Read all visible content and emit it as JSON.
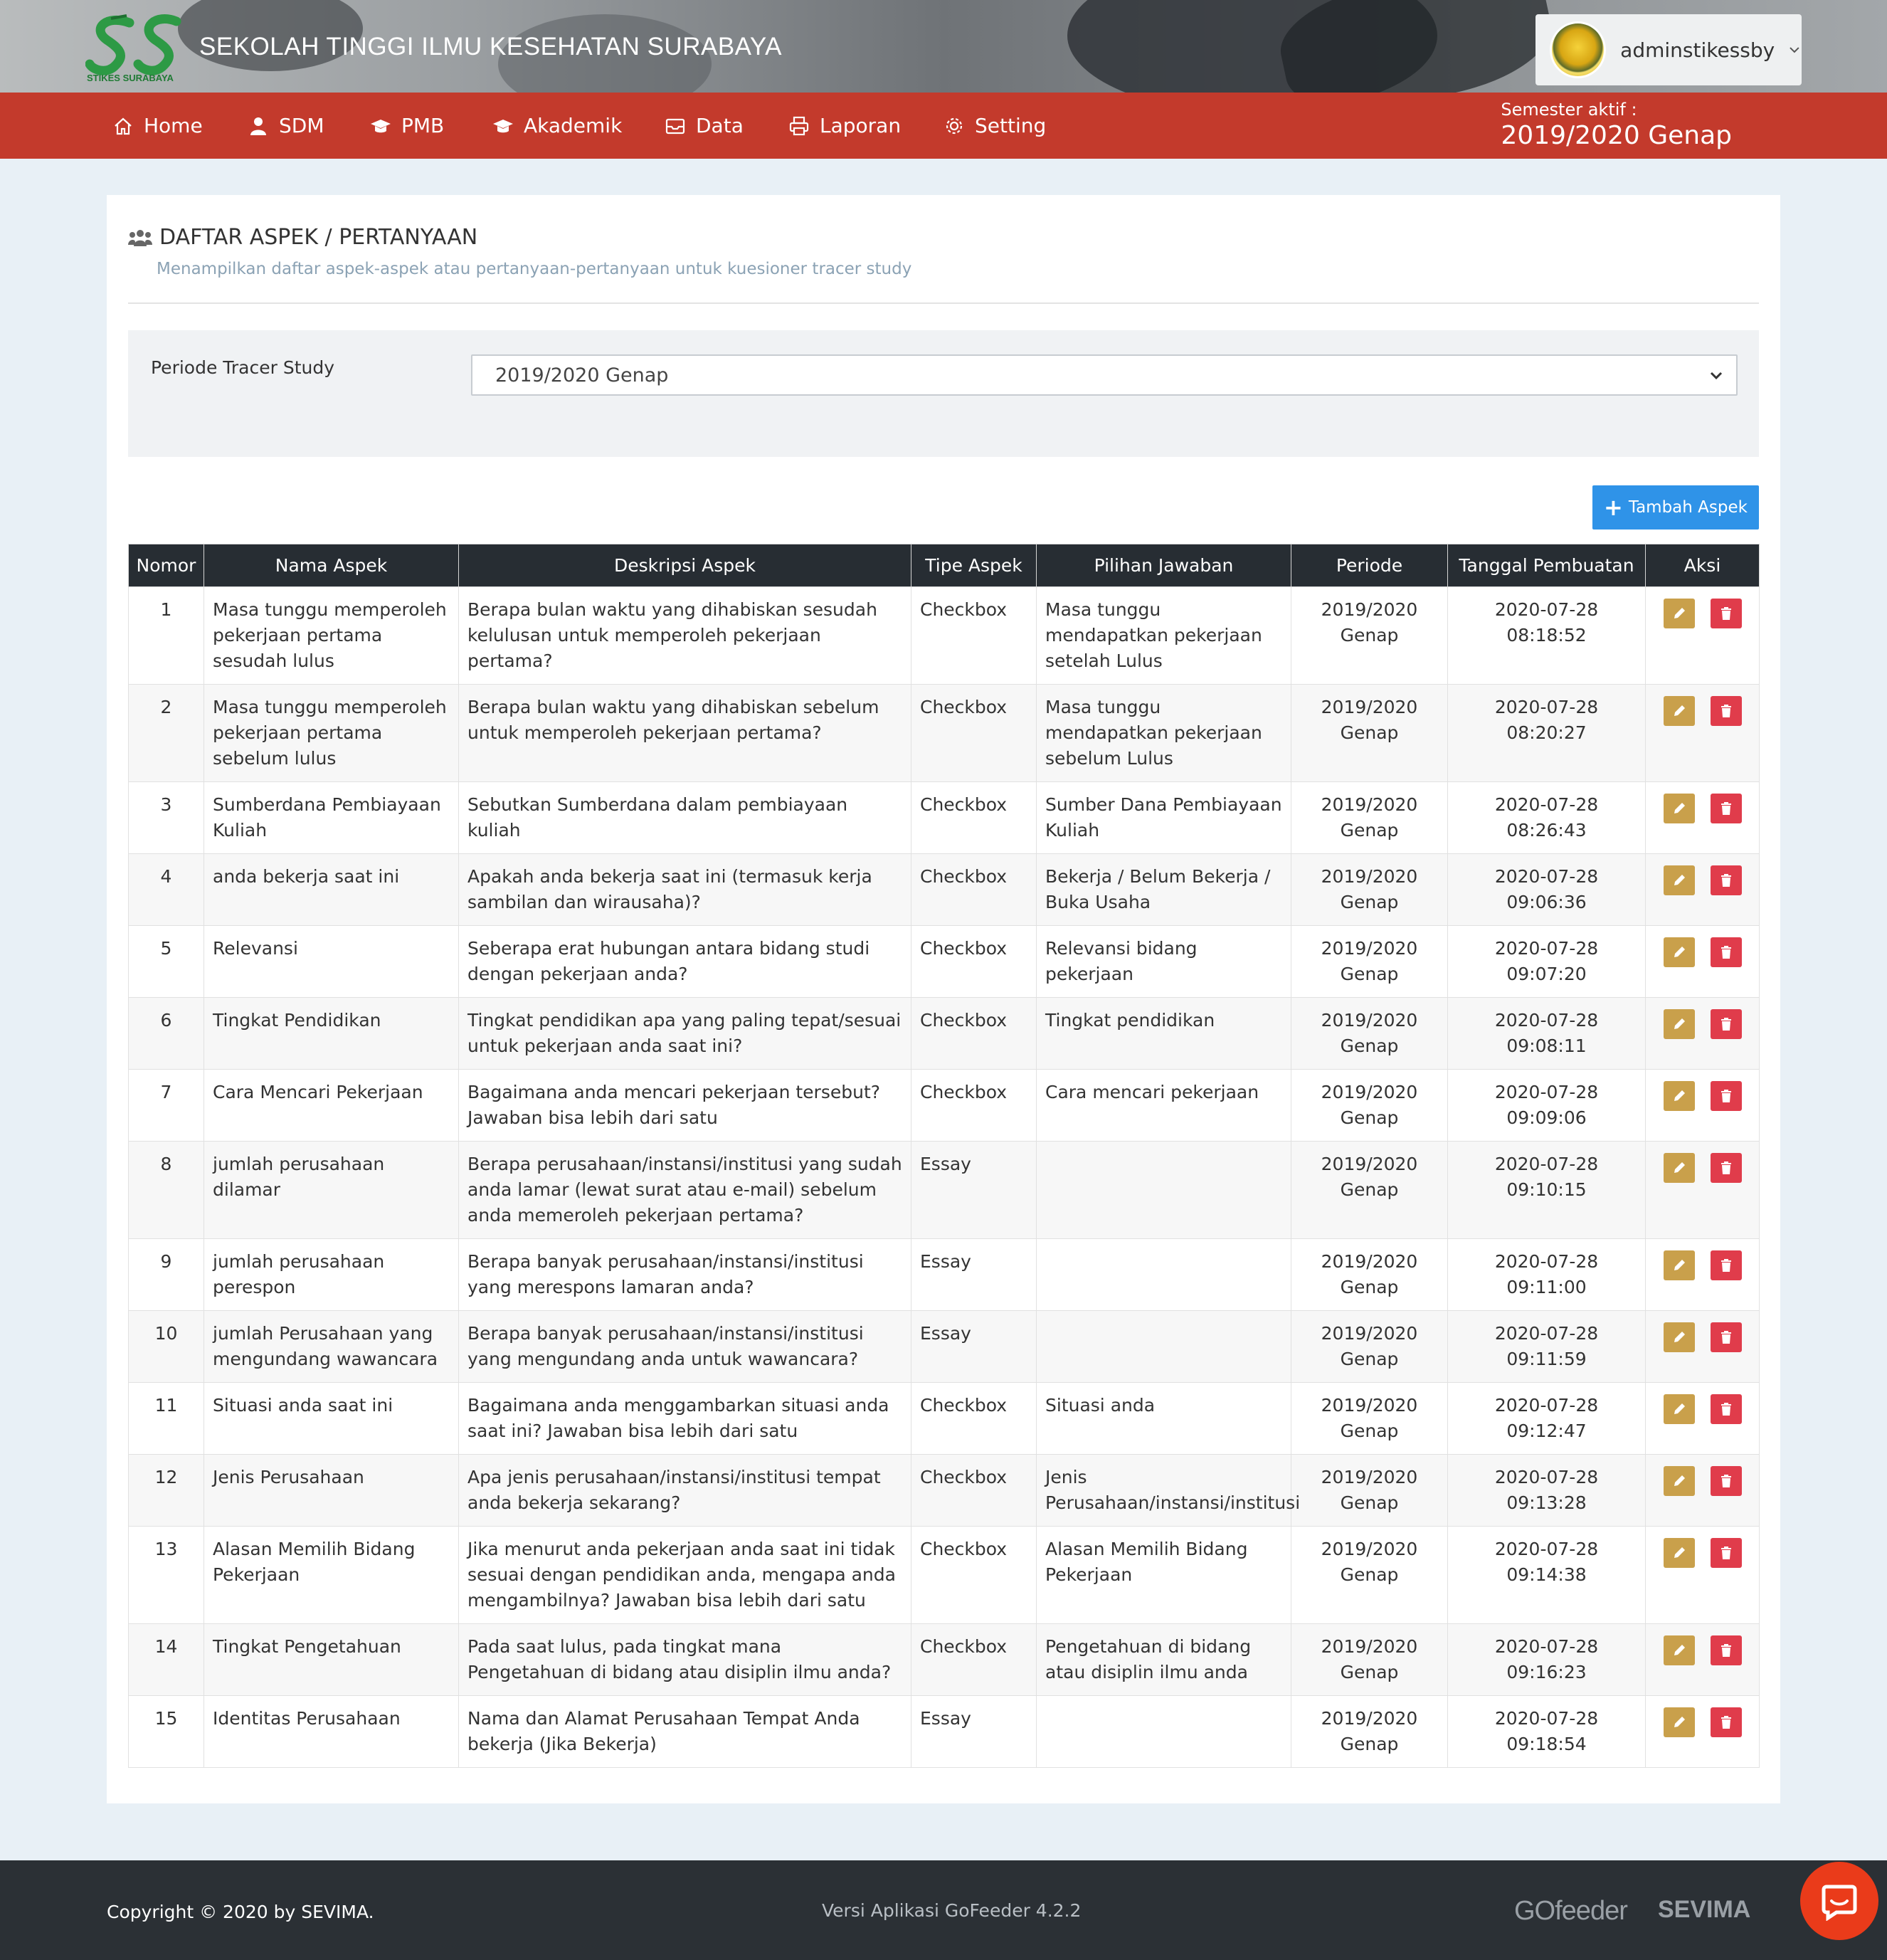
{
  "header": {
    "logo_caption": "STIKES SURABAYA",
    "site_title": "SEKOLAH TINGGI ILMU KESEHATAN SURABAYA",
    "username": "adminstikessby"
  },
  "nav": {
    "items": [
      {
        "label": "Home",
        "icon": "home-icon"
      },
      {
        "label": "SDM",
        "icon": "user-icon"
      },
      {
        "label": "PMB",
        "icon": "graduation-cap-icon"
      },
      {
        "label": "Akademik",
        "icon": "graduation-cap-icon"
      },
      {
        "label": "Data",
        "icon": "inbox-icon"
      },
      {
        "label": "Laporan",
        "icon": "print-icon"
      },
      {
        "label": "Setting",
        "icon": "gear-icon"
      }
    ],
    "semester_label": "Semester aktif :",
    "semester_value": "2019/2020 Genap"
  },
  "page": {
    "title": "DAFTAR ASPEK / PERTANYAAN",
    "subtitle": "Menampilkan daftar aspek-aspek atau pertanyaan-pertanyaan untuk kuesioner tracer study",
    "filter_label": "Periode Tracer Study",
    "filter_value": "2019/2020 Genap",
    "add_button": "Tambah Aspek"
  },
  "table": {
    "headers": [
      "Nomor",
      "Nama Aspek",
      "Deskripsi Aspek",
      "Tipe Aspek",
      "Pilihan Jawaban",
      "Periode",
      "Tanggal Pembuatan",
      "Aksi"
    ],
    "rows": [
      {
        "no": "1",
        "nama": "Masa tunggu memperoleh pekerjaan pertama sesudah lulus",
        "deskripsi": "Berapa bulan waktu yang dihabiskan sesudah kelulusan untuk memperoleh pekerjaan pertama?",
        "tipe": "Checkbox",
        "pilihan": "Masa tunggu mendapatkan pekerjaan setelah Lulus",
        "periode": "2019/2020 Genap",
        "tanggal": "2020-07-28 08:18:52"
      },
      {
        "no": "2",
        "nama": "Masa tunggu memperoleh pekerjaan pertama sebelum lulus",
        "deskripsi": "Berapa bulan waktu yang dihabiskan sebelum untuk memperoleh pekerjaan pertama?",
        "tipe": "Checkbox",
        "pilihan": "Masa tunggu mendapatkan pekerjaan sebelum Lulus",
        "periode": "2019/2020 Genap",
        "tanggal": "2020-07-28 08:20:27"
      },
      {
        "no": "3",
        "nama": "Sumberdana Pembiayaan Kuliah",
        "deskripsi": "Sebutkan Sumberdana dalam pembiayaan kuliah",
        "tipe": "Checkbox",
        "pilihan": "Sumber Dana Pembiayaan Kuliah",
        "periode": "2019/2020 Genap",
        "tanggal": "2020-07-28 08:26:43"
      },
      {
        "no": "4",
        "nama": "anda bekerja saat ini",
        "deskripsi": "Apakah anda bekerja saat ini (termasuk kerja sambilan dan wirausaha)?",
        "tipe": "Checkbox",
        "pilihan": "Bekerja / Belum Bekerja / Buka Usaha",
        "periode": "2019/2020 Genap",
        "tanggal": "2020-07-28 09:06:36"
      },
      {
        "no": "5",
        "nama": "Relevansi",
        "deskripsi": "Seberapa erat hubungan antara bidang studi dengan pekerjaan anda?",
        "tipe": "Checkbox",
        "pilihan": "Relevansi bidang pekerjaan",
        "periode": "2019/2020 Genap",
        "tanggal": "2020-07-28 09:07:20"
      },
      {
        "no": "6",
        "nama": "Tingkat Pendidikan",
        "deskripsi": "Tingkat pendidikan apa yang paling tepat/sesuai untuk pekerjaan anda saat ini?",
        "tipe": "Checkbox",
        "pilihan": "Tingkat pendidikan",
        "periode": "2019/2020 Genap",
        "tanggal": "2020-07-28 09:08:11"
      },
      {
        "no": "7",
        "nama": "Cara Mencari Pekerjaan",
        "deskripsi": "Bagaimana anda mencari pekerjaan tersebut? Jawaban bisa lebih dari satu",
        "tipe": "Checkbox",
        "pilihan": "Cara mencari pekerjaan",
        "periode": "2019/2020 Genap",
        "tanggal": "2020-07-28 09:09:06"
      },
      {
        "no": "8",
        "nama": "jumlah perusahaan dilamar",
        "deskripsi": "Berapa perusahaan/instansi/institusi yang sudah anda lamar (lewat surat atau e-mail) sebelum anda memeroleh pekerjaan pertama?",
        "tipe": "Essay",
        "pilihan": "",
        "periode": "2019/2020 Genap",
        "tanggal": "2020-07-28 09:10:15"
      },
      {
        "no": "9",
        "nama": "jumlah perusahaan perespon",
        "deskripsi": "Berapa banyak perusahaan/instansi/institusi yang merespons lamaran anda?",
        "tipe": "Essay",
        "pilihan": "",
        "periode": "2019/2020 Genap",
        "tanggal": "2020-07-28 09:11:00"
      },
      {
        "no": "10",
        "nama": "jumlah Perusahaan yang mengundang wawancara",
        "deskripsi": "Berapa banyak perusahaan/instansi/institusi yang mengundang anda untuk wawancara?",
        "tipe": "Essay",
        "pilihan": "",
        "periode": "2019/2020 Genap",
        "tanggal": "2020-07-28 09:11:59"
      },
      {
        "no": "11",
        "nama": "Situasi anda saat ini",
        "deskripsi": "Bagaimana anda menggambarkan situasi anda saat ini? Jawaban bisa lebih dari satu",
        "tipe": "Checkbox",
        "pilihan": "Situasi anda",
        "periode": "2019/2020 Genap",
        "tanggal": "2020-07-28 09:12:47"
      },
      {
        "no": "12",
        "nama": "Jenis Perusahaan",
        "deskripsi": "Apa jenis perusahaan/instansi/institusi tempat anda bekerja sekarang?",
        "tipe": "Checkbox",
        "pilihan": "Jenis Perusahaan/instansi/institusi",
        "periode": "2019/2020 Genap",
        "tanggal": "2020-07-28 09:13:28"
      },
      {
        "no": "13",
        "nama": "Alasan Memilih Bidang Pekerjaan",
        "deskripsi": "Jika menurut anda pekerjaan anda saat ini tidak sesuai dengan pendidikan anda, mengapa anda mengambilnya? Jawaban bisa lebih dari satu",
        "tipe": "Checkbox",
        "pilihan": "Alasan Memilih Bidang Pekerjaan",
        "periode": "2019/2020 Genap",
        "tanggal": "2020-07-28 09:14:38"
      },
      {
        "no": "14",
        "nama": "Tingkat Pengetahuan",
        "deskripsi": "Pada saat lulus, pada tingkat mana Pengetahuan di bidang atau disiplin ilmu anda?",
        "tipe": "Checkbox",
        "pilihan": "Pengetahuan di bidang atau disiplin ilmu anda",
        "periode": "2019/2020 Genap",
        "tanggal": "2020-07-28 09:16:23"
      },
      {
        "no": "15",
        "nama": "Identitas Perusahaan",
        "deskripsi": "Nama dan Alamat Perusahaan Tempat Anda bekerja (Jika Bekerja)",
        "tipe": "Essay",
        "pilihan": "",
        "periode": "2019/2020 Genap",
        "tanggal": "2020-07-28 09:18:54"
      }
    ]
  },
  "footer": {
    "copyright": "Copyright © 2020 by SEVIMA.",
    "version": "Versi Aplikasi GoFeeder 4.2.2",
    "brand1": "GOfeeder",
    "brand2": "SEVIMA"
  },
  "colors": {
    "navbar": "#c33a2c",
    "table_header": "#272d33",
    "add_button": "#2f93e8",
    "edit_button": "#c9a04b",
    "delete_button": "#e03c4b",
    "footer": "#2b3035"
  }
}
